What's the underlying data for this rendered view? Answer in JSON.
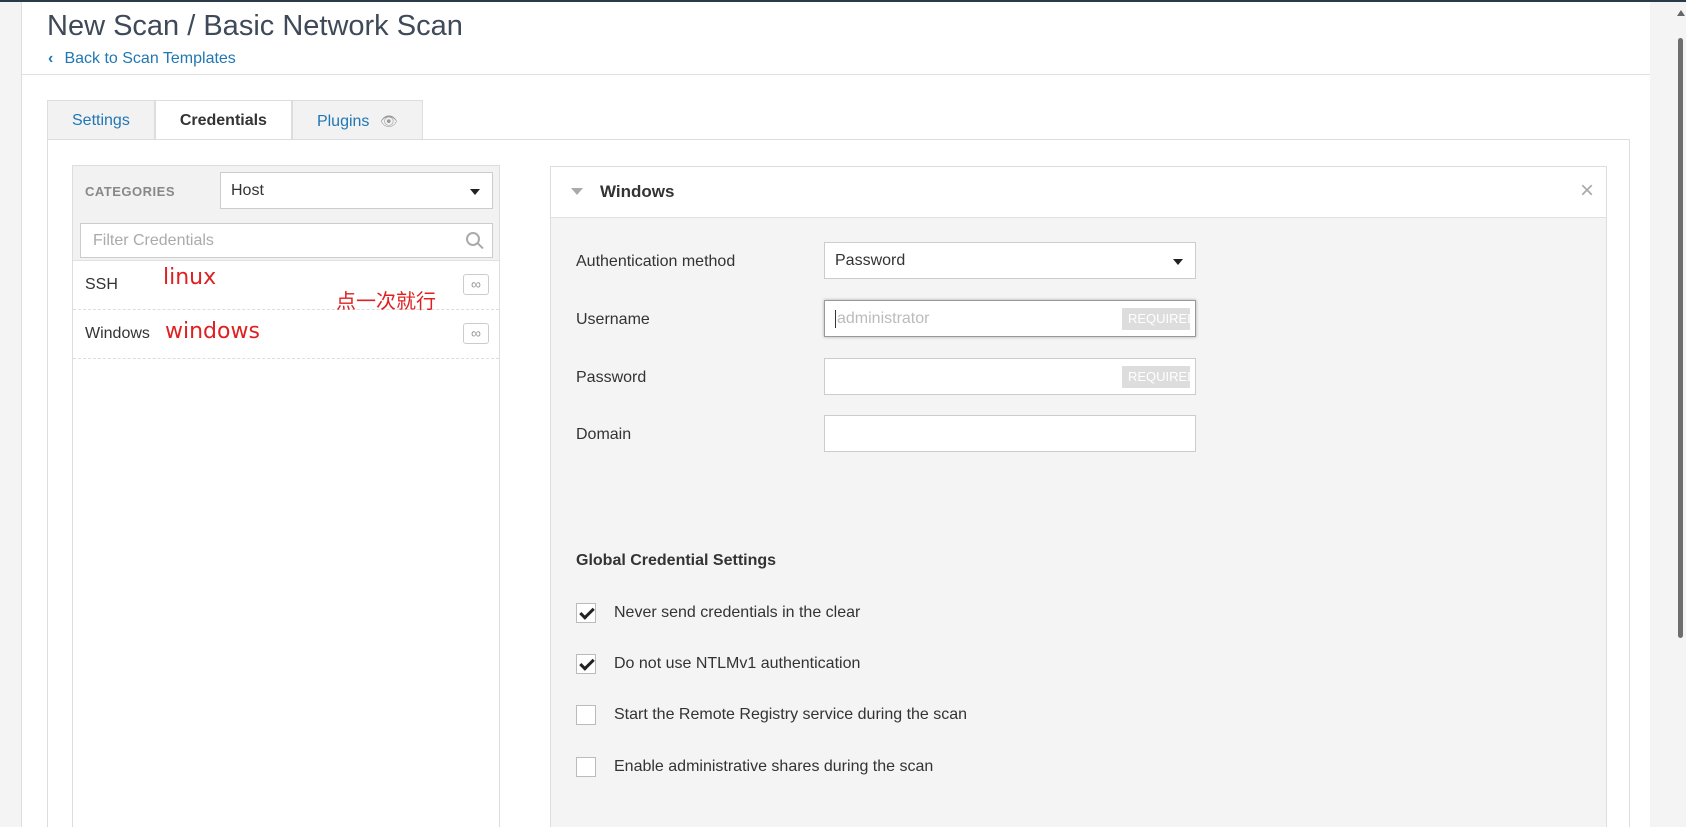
{
  "header": {
    "title": "New Scan / Basic Network Scan",
    "back_link": "Back to Scan Templates"
  },
  "tabs": [
    {
      "label": "Settings"
    },
    {
      "label": "Credentials"
    },
    {
      "label": "Plugins"
    }
  ],
  "left_panel": {
    "categories_label": "CATEGORIES",
    "category_value": "Host",
    "filter_placeholder": "Filter Credentials",
    "items": [
      {
        "label": "SSH",
        "badge": "∞"
      },
      {
        "label": "Windows",
        "badge": "∞"
      }
    ]
  },
  "annotations": {
    "linux": "linux",
    "windows": "windows",
    "once": "点一次就行"
  },
  "right_panel": {
    "title": "Windows",
    "auth_method_label": "Authentication method",
    "auth_method_value": "Password",
    "username_label": "Username",
    "username_placeholder": "administrator",
    "password_label": "Password",
    "domain_label": "Domain",
    "required_badge": "REQUIRED",
    "global_title": "Global Credential Settings",
    "checks": [
      {
        "label": "Never send credentials in the clear",
        "checked": true
      },
      {
        "label": "Do not use NTLMv1 authentication",
        "checked": true
      },
      {
        "label": "Start the Remote Registry service during the scan",
        "checked": false
      },
      {
        "label": "Enable administrative shares during the scan",
        "checked": false
      }
    ]
  }
}
